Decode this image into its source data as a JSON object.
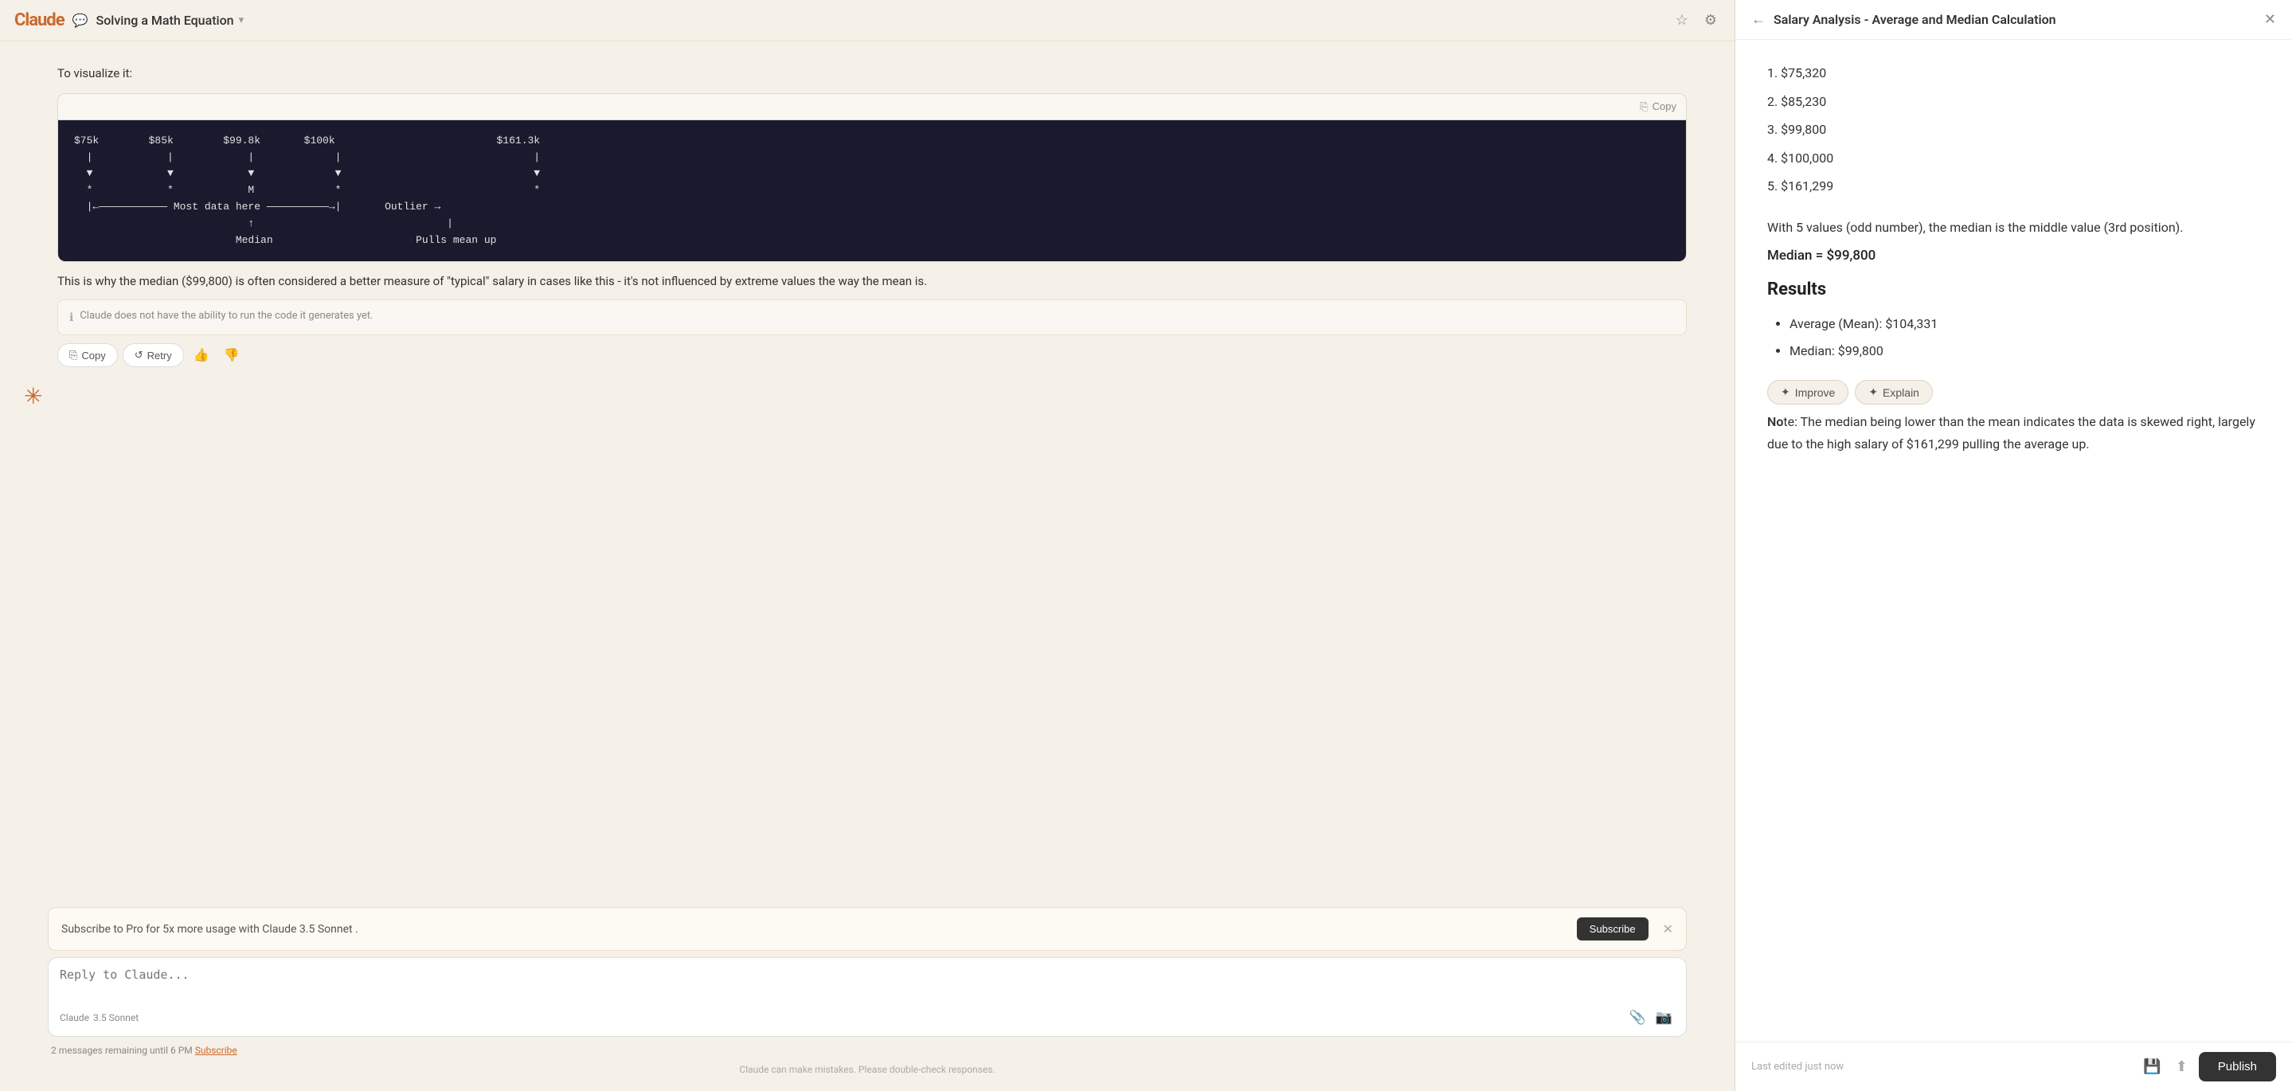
{
  "app": {
    "logo": "Claude",
    "chat_icon": "💬",
    "title": "Solving a Math Equation",
    "chevron": "▾",
    "fav_icon": "☆",
    "settings_icon": "⚙"
  },
  "chat": {
    "message1": {
      "lead_text": "To visualize it:",
      "code_copy_label": "Copy",
      "code_content": "$75k        $85k        $99.8k       $100k                          $161.3k\n  |            |            |             |                               |\n  ▼            ▼            ▼             ▼                               ▼\n  *            *            M             *                               *\n  |←——————————— Most data here ——————————→|       Outlier →\n                            ↑                               |\n                          Median                       Pulls mean up",
      "text1": "This is why the median ($99,800) is often considered a better measure of \"typical\" salary in cases like this - it's not influenced by extreme values the way the mean is.",
      "info_text": "Claude does not have the ability to run the code it generates yet.",
      "copy_label": "Copy",
      "retry_label": "Retry"
    },
    "avatar_symbol": "✳",
    "footer": {
      "subscribe_text": "Subscribe to Pro for 5x more usage with ",
      "subscribe_highlight": "Claude 3.5 Sonnet",
      "subscribe_suffix": ".",
      "subscribe_btn_label": "Subscribe",
      "reply_placeholder": "Reply to Claude...",
      "model_label": "Claude",
      "model_version": "3.5 Sonnet",
      "messages_remaining": "2 messages",
      "remaining_label": "remaining until 6 PM",
      "subscribe_link_label": "Subscribe",
      "disclaimer": "Claude can make mistakes. Please double-check responses."
    }
  },
  "right_panel": {
    "title": "Salary Analysis - Average and Median Calculation",
    "list_items": [
      "1. $75,320",
      "2. $85,230",
      "3. $99,800",
      "4. $100,000",
      "5. $161,299"
    ],
    "section_text": "With 5 values (odd number), the median is the middle value (3rd position).",
    "formula": "Median = $99,800",
    "results_heading": "Results",
    "results": [
      "Average (Mean): $104,331",
      "Median: $99,800"
    ],
    "note_prefix": "No",
    "note_text": "te: The median being lower than the mean indicates the data is skewed right, largely due to the high salary of $161,299 pulling the average up.",
    "improve_label": "Improve",
    "explain_label": "Explain",
    "last_edited": "Last edited just now",
    "publish_label": "Publish"
  },
  "icons": {
    "copy": "⎘",
    "retry": "↺",
    "thumb_up": "👍",
    "thumb_down": "👎",
    "attach": "📎",
    "camera": "📷",
    "back_arrow": "←",
    "close": "✕",
    "save": "💾",
    "export": "⬆",
    "info": "ℹ",
    "improve": "✦",
    "explain": "✦"
  }
}
